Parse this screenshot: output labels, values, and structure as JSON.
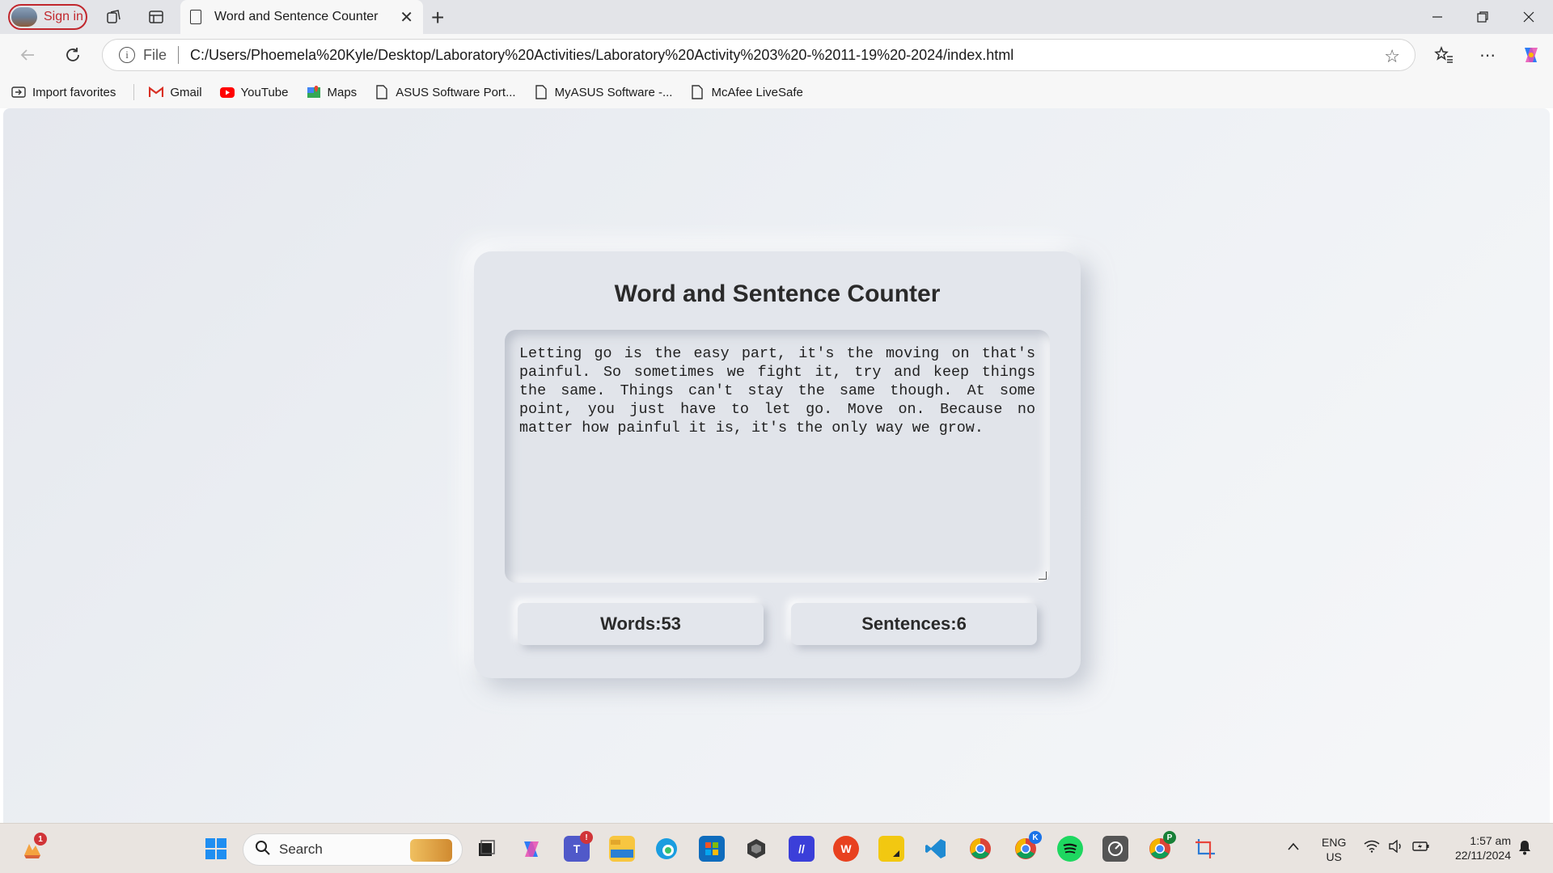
{
  "browser": {
    "signin_label": "Sign in",
    "tab_title": "Word and Sentence Counter",
    "address_scheme": "File",
    "address_url": "C:/Users/Phoemela%20Kyle/Desktop/Laboratory%20Activities/Laboratory%20Activity%203%20-%2011-19%20-2024/index.html",
    "bookmarks": [
      {
        "label": "Import favorites",
        "icon": "import-icon"
      },
      {
        "label": "Gmail",
        "icon": "gmail-icon"
      },
      {
        "label": "YouTube",
        "icon": "youtube-icon"
      },
      {
        "label": "Maps",
        "icon": "maps-icon"
      },
      {
        "label": "ASUS Software Port...",
        "icon": "page-icon"
      },
      {
        "label": "MyASUS Software -...",
        "icon": "page-icon"
      },
      {
        "label": "McAfee LiveSafe",
        "icon": "page-icon"
      }
    ]
  },
  "page": {
    "heading": "Word and Sentence Counter",
    "text_value": "Letting go is the easy part, it's the moving on that's painful. So sometimes we fight it, try and keep things the same. Things can't stay the same though. At some point, you just have to let go. Move on. Because no matter how painful it is, it's the only way we grow.",
    "words_label": "Words:53",
    "sentences_label": "Sentences:6"
  },
  "taskbar": {
    "search_placeholder": "Search",
    "weather_badge": "1",
    "language": "ENG",
    "region": "US",
    "time": "1:57 am",
    "date": "22/11/2024"
  }
}
